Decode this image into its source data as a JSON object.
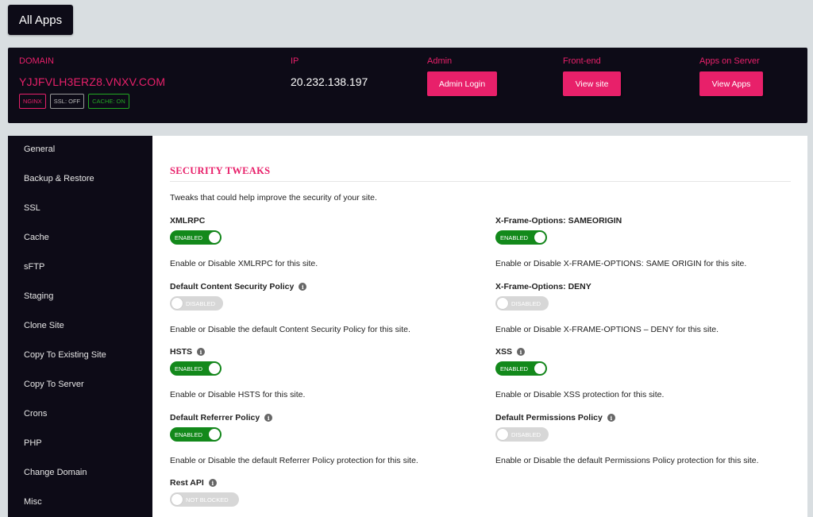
{
  "top": {
    "all_apps_label": "All Apps"
  },
  "header": {
    "domain_label": "DOMAIN",
    "domain_value": "YJJFVLH3ERZ8.VNXV.COM",
    "badges": [
      "NGINX",
      "SSL: OFF",
      "CACHE: ON"
    ],
    "ip_label": "IP",
    "ip_value": "20.232.138.197",
    "admin_label": "Admin",
    "admin_button": "Admin Login",
    "frontend_label": "Front-end",
    "frontend_button": "View site",
    "apps_label": "Apps on Server",
    "apps_button": "View Apps"
  },
  "sidebar": {
    "items": [
      "General",
      "Backup & Restore",
      "SSL",
      "Cache",
      "sFTP",
      "Staging",
      "Clone Site",
      "Copy To Existing Site",
      "Copy To Server",
      "Crons",
      "PHP",
      "Change Domain",
      "Misc"
    ]
  },
  "main": {
    "section_title": "SECURITY TWEAKS",
    "intro": "Tweaks that could help improve the security of your site.",
    "settings": [
      {
        "label": "XMLRPC",
        "state": "ENABLED",
        "on": true,
        "info": false,
        "desc": "Enable or Disable XMLRPC for this site."
      },
      {
        "label": "X-Frame-Options: SAMEORIGIN",
        "state": "ENABLED",
        "on": true,
        "info": false,
        "desc": "Enable or Disable X-FRAME-OPTIONS: SAME ORIGIN for this site."
      },
      {
        "label": "Default Content Security Policy",
        "state": "DISABLED",
        "on": false,
        "info": true,
        "desc": "Enable or Disable the default Content Security Policy for this site."
      },
      {
        "label": "X-Frame-Options: DENY",
        "state": "DISABLED",
        "on": false,
        "info": false,
        "desc": "Enable or Disable X-FRAME-OPTIONS – DENY for this site."
      },
      {
        "label": "HSTS",
        "state": "ENABLED",
        "on": true,
        "info": true,
        "desc": "Enable or Disable HSTS for this site."
      },
      {
        "label": "XSS",
        "state": "ENABLED",
        "on": true,
        "info": true,
        "desc": "Enable or Disable XSS protection for this site."
      },
      {
        "label": "Default Referrer Policy",
        "state": "ENABLED",
        "on": true,
        "info": true,
        "desc": "Enable or Disable the default Referrer Policy protection for this site."
      },
      {
        "label": "Default Permissions Policy",
        "state": "DISABLED",
        "on": false,
        "info": true,
        "desc": "Enable or Disable the default Permissions Policy protection for this site."
      },
      {
        "label": "Rest API",
        "state": "NOT BLOCKED",
        "on": false,
        "info": true,
        "desc": ""
      }
    ]
  },
  "colors": {
    "accent": "#e8206a",
    "dark": "#0d0b17",
    "enabled": "#13891b",
    "disabled": "#d7d7d7"
  }
}
